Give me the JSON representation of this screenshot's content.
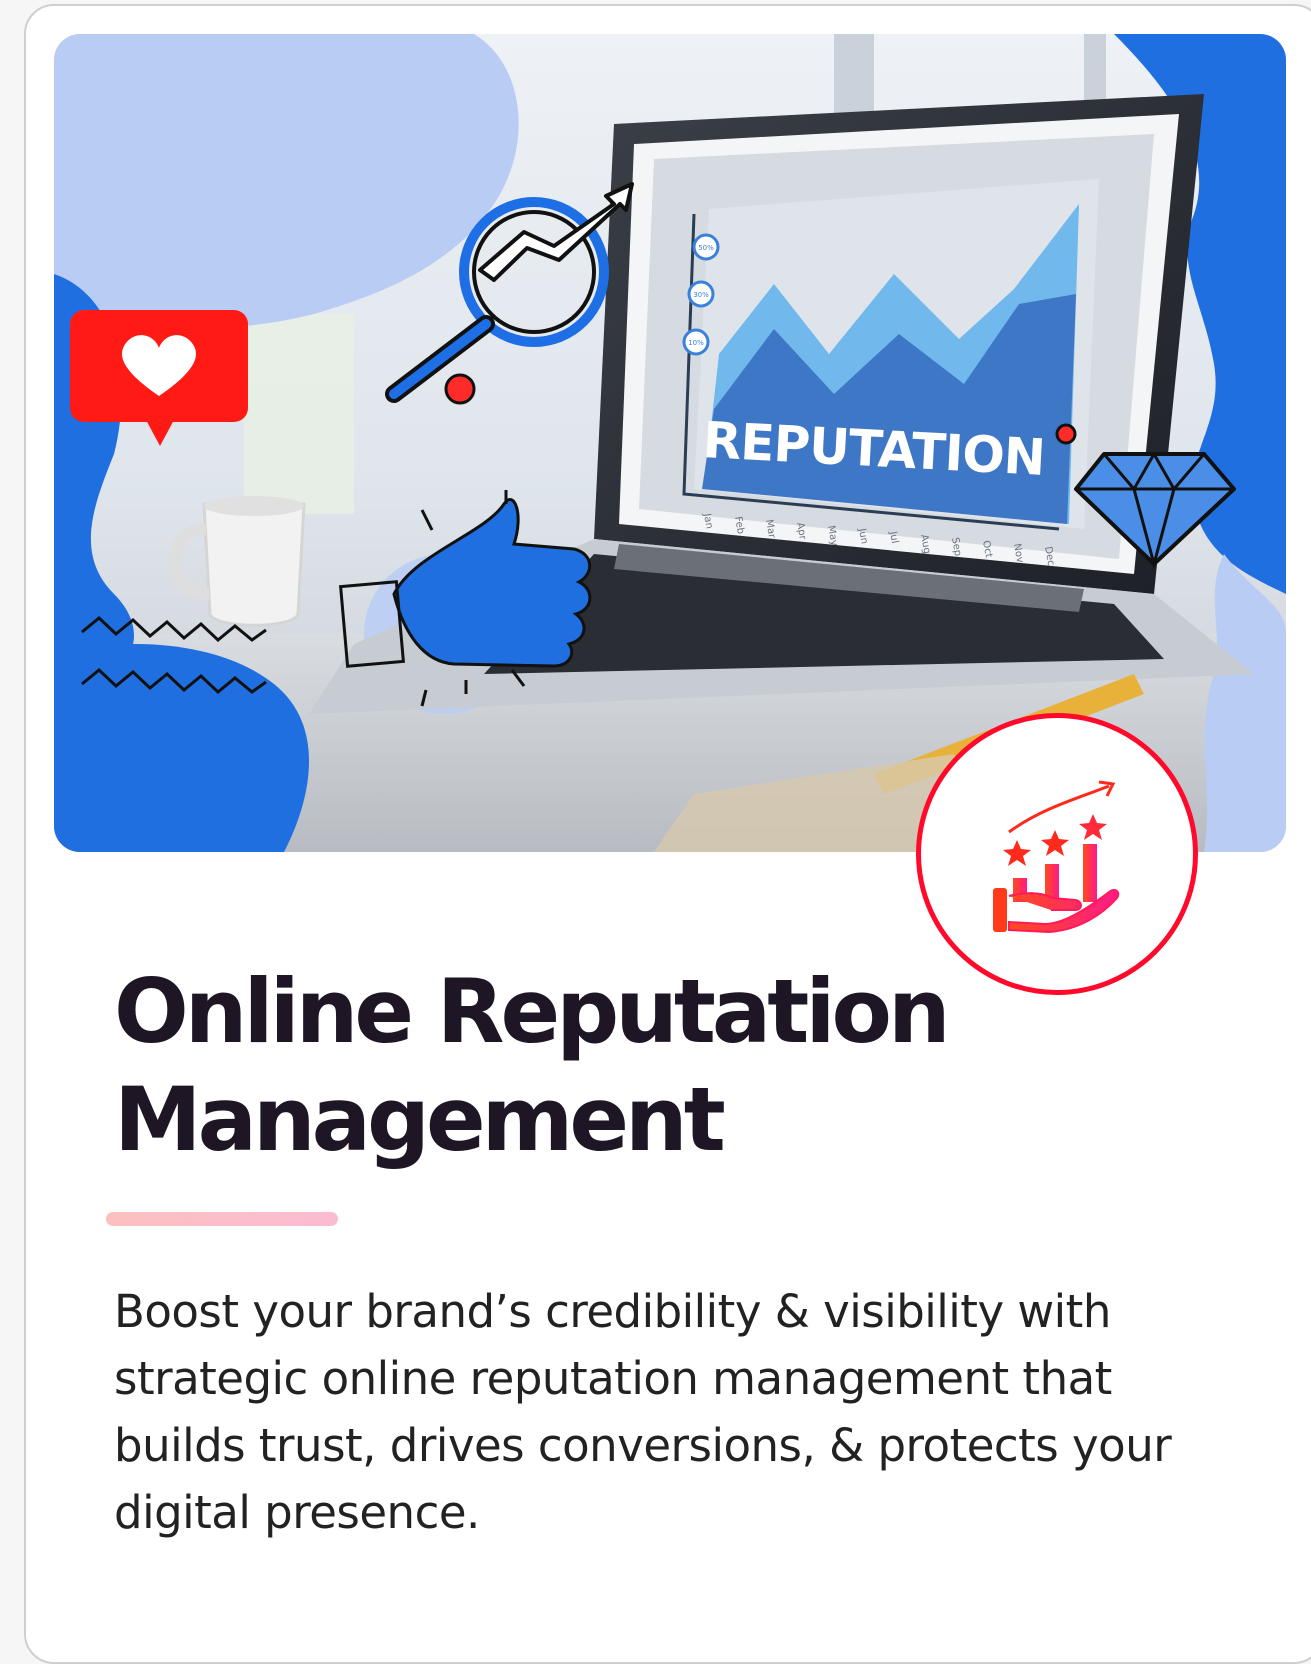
{
  "card": {
    "title": "Online Reputation Management",
    "description": "Boost your brand’s credibility & visibility with strategic online reputation management that builds trust, drives conversions, & protects your digital presence."
  },
  "hero_image": {
    "screen_text": "REPUTATION",
    "months": [
      "Jan",
      "Feb",
      "Mar",
      "Apr",
      "May",
      "Jun",
      "Jul",
      "Aug",
      "Sep",
      "Oct",
      "Nov",
      "Dec"
    ],
    "percent_labels": [
      "50%",
      "30%",
      "10%"
    ]
  },
  "badge": {
    "icon": "rating-growth-hand-icon"
  },
  "colors": {
    "accent_red": "#ff0a2b",
    "blob_blue": "#1f6fe0",
    "blob_light": "#b9cdf4",
    "title": "#1f1625",
    "divider": "#fdbfc4"
  }
}
